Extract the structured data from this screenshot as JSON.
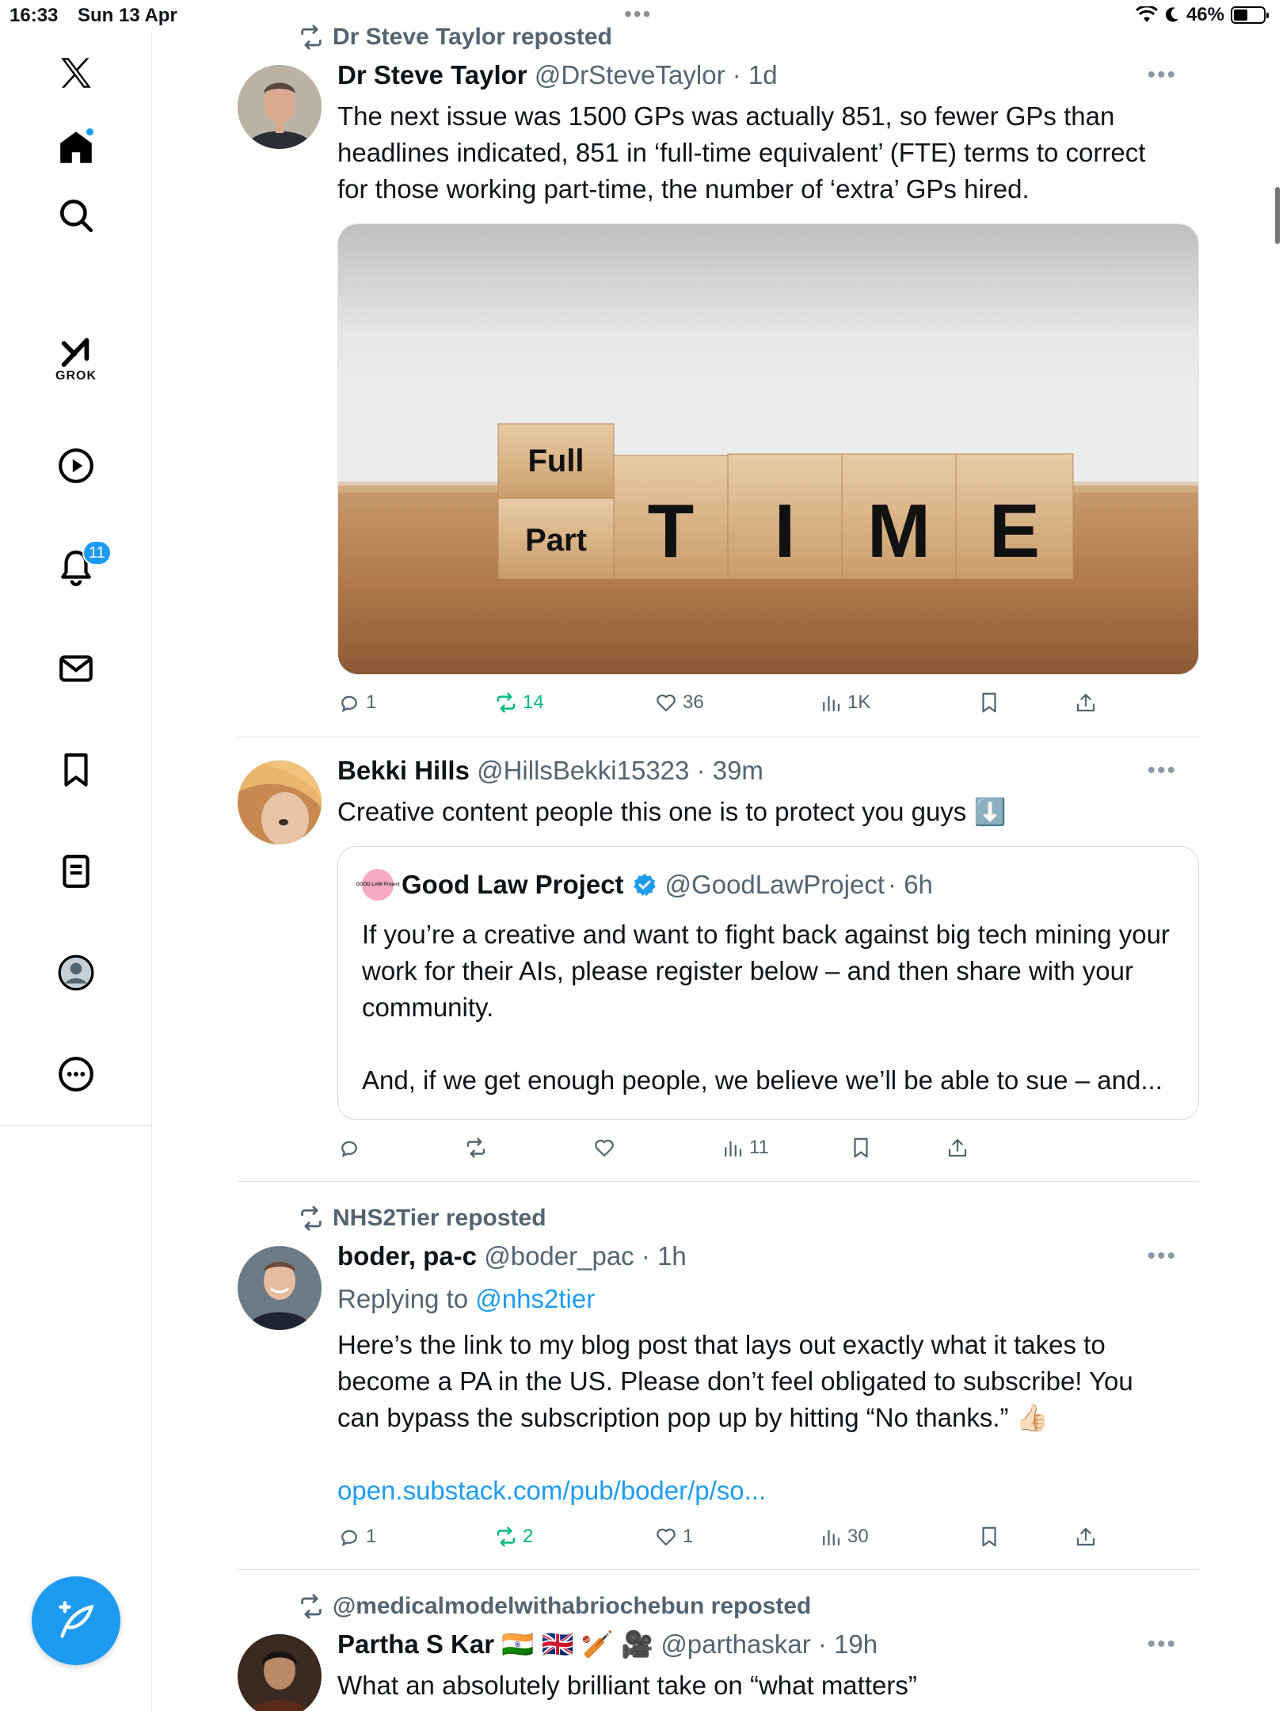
{
  "status_bar": {
    "time": "16:33",
    "date": "Sun 13 Apr",
    "battery": "46%"
  },
  "sidebar": {
    "items": [
      {
        "name": "x-logo"
      },
      {
        "name": "home",
        "has_dot": true
      },
      {
        "name": "search"
      },
      {
        "name": "grok",
        "label": "GROK"
      },
      {
        "name": "video"
      },
      {
        "name": "notifications",
        "count": "11"
      },
      {
        "name": "messages"
      },
      {
        "name": "bookmarks"
      },
      {
        "name": "lists"
      },
      {
        "name": "profile"
      },
      {
        "name": "more"
      }
    ],
    "accent": "#1d9bf0"
  },
  "tweets": [
    {
      "repost_by": "Dr Steve Taylor reposted",
      "name": "Dr Steve Taylor",
      "handle": "@DrSteveTaylor",
      "time": "· 1d",
      "text": "The next issue was 1500 GPs was actually 851, so fewer GPs than headlines indicated, 851 in ‘full-time equivalent’ (FTE) terms to correct for those working part-time, the number of ‘extra’ GPs hired.",
      "media": {
        "top_word": "Full",
        "bottom_word": "Part",
        "letters": [
          "T",
          "I",
          "M",
          "E"
        ]
      },
      "replies": "1",
      "reposts": "14",
      "likes": "36",
      "views": "1K"
    },
    {
      "name": "Bekki Hills",
      "handle": "@HillsBekki15323",
      "time": "· 39m",
      "text": "Creative content people this one is to protect you guys",
      "emoji": "⬇️",
      "quote": {
        "avatar_text": "GOOD LAW Project",
        "name": "Good Law Project",
        "handle": "@GoodLawProject",
        "time": "· 6h",
        "text_1": "If you’re a creative and want to fight back against big tech mining your work for their AIs, please register below – and then share with your community.",
        "text_2": "And, if we get enough people, we believe we’ll be able to sue – and..."
      },
      "replies": "",
      "reposts": "",
      "likes": "",
      "views": "11"
    },
    {
      "repost_by": "NHS2Tier reposted",
      "name": "boder, pa-c",
      "handle": "@boder_pac",
      "time": "· 1h",
      "replying_prefix": "Replying to",
      "replying_to": "@nhs2tier",
      "text": "Here’s the link to my blog post that lays out exactly what it takes to become a PA in the US. Please don’t feel obligated to subscribe! You can  bypass the subscription pop up by hitting “No thanks.” 👍🏻",
      "link": "open.substack.com/pub/boder/p/so...",
      "replies": "1",
      "reposts": "2",
      "likes": "1",
      "views": "30"
    },
    {
      "repost_by": "@medicalmodelwithabriochebun reposted",
      "name": "Partha S Kar",
      "name_emoji": "🇮🇳 🇬🇧 🏏 🎥",
      "handle": "@parthaskar",
      "time": "· 19h",
      "text": "What an absolutely brilliant take on “what matters”"
    }
  ]
}
